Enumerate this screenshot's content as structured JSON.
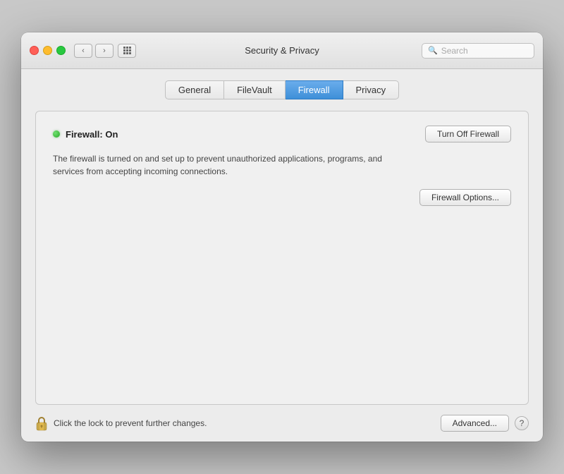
{
  "window": {
    "title": "Security & Privacy"
  },
  "titlebar": {
    "back_btn": "‹",
    "forward_btn": "›"
  },
  "search": {
    "placeholder": "Search"
  },
  "tabs": [
    {
      "id": "general",
      "label": "General",
      "active": false
    },
    {
      "id": "filevault",
      "label": "FileVault",
      "active": false
    },
    {
      "id": "firewall",
      "label": "Firewall",
      "active": true
    },
    {
      "id": "privacy",
      "label": "Privacy",
      "active": false
    }
  ],
  "firewall": {
    "status_dot_color": "#28a828",
    "status_label": "Firewall: On",
    "turn_off_button": "Turn Off Firewall",
    "description": "The firewall is turned on and set up to prevent unauthorized applications, programs, and services from accepting incoming connections.",
    "options_button": "Firewall Options..."
  },
  "bottom": {
    "lock_text": "Click the lock to prevent further changes.",
    "advanced_button": "Advanced...",
    "help_label": "?"
  }
}
